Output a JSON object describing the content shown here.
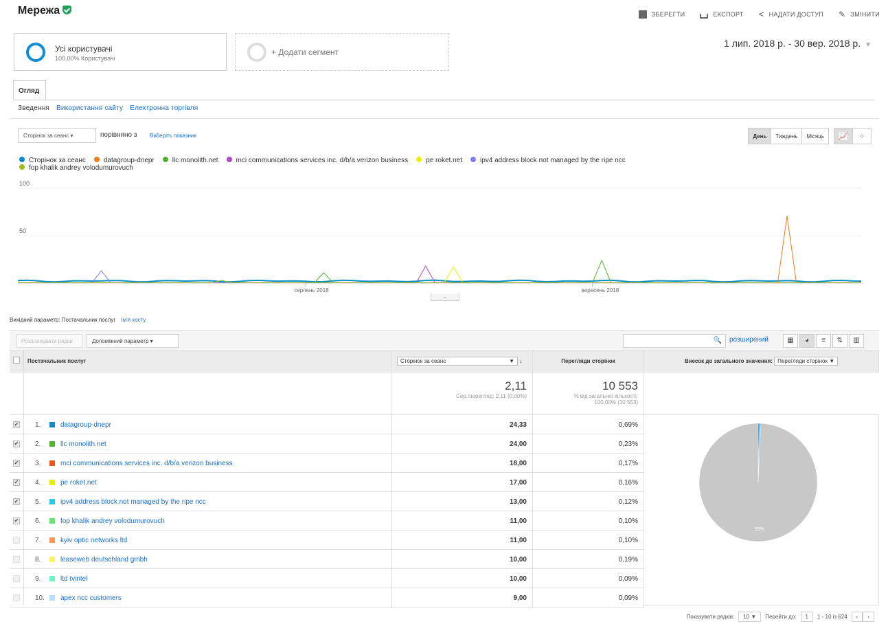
{
  "header": {
    "title": "Мережа",
    "save": "ЗБЕРЕГТИ",
    "export": "ЕКСПОРТ",
    "share": "НАДАТИ ДОСТУП",
    "edit": "ЗМІНИТИ"
  },
  "segments": {
    "all_users": "Усі користувачі",
    "all_users_sub": "100,00% Користувачі",
    "add": "+ Додати сегмент"
  },
  "date_range": "1 лип. 2018 р. - 30 вер. 2018 р.",
  "tab": "Огляд",
  "subnav": [
    "Зведення",
    "Використання сайту",
    "Електронна торгівля"
  ],
  "chart_controls": {
    "metric": "Сторінок за сеанс",
    "compare": "порівняно з",
    "choose_metric": "Виберіть показник",
    "day": "День",
    "week": "Тиждень",
    "month": "Місяць"
  },
  "chart_data": {
    "type": "line",
    "y_ticks": [
      "100",
      "50"
    ],
    "ylim": [
      0,
      100
    ],
    "x_ticks": [
      "серпень 2018",
      "вересень 2018"
    ],
    "series": [
      {
        "name": "Сторінок за сеанс",
        "color": "#058dc7",
        "peaks": []
      },
      {
        "name": "datagroup-dnepr",
        "color": "#ed7e17",
        "peaks": [
          {
            "day": 83,
            "value": 71
          }
        ]
      },
      {
        "name": "llc monolith.net",
        "color": "#50b432",
        "peaks": [
          {
            "day": 63,
            "value": 24
          },
          {
            "day": 33,
            "value": 11
          }
        ]
      },
      {
        "name": "mci communications services inc. d/b/a verizon business",
        "color": "#af49c5",
        "peaks": [
          {
            "day": 44,
            "value": 18
          }
        ]
      },
      {
        "name": "pe roket.net",
        "color": "#edef00",
        "peaks": [
          {
            "day": 47,
            "value": 17
          }
        ]
      },
      {
        "name": "ipv4 address block not managed by the ripe ncc",
        "color": "#8080ff",
        "peaks": [
          {
            "day": 9,
            "value": 13
          }
        ]
      },
      {
        "name": "fop khalik andrey volodumurovuch",
        "color": "#a0bd13",
        "peaks": [
          {
            "day": 22,
            "value": 3
          }
        ]
      }
    ]
  },
  "table": {
    "primary_label": "Вихідний параметр:",
    "primary_value": "Постачальник послуг",
    "primary_alt": "Ім'я хосту",
    "plot_rows": "Розпланувати рядки",
    "secondary": "Допоміжний параметр",
    "advanced": "розширений",
    "col_dim": "Постачальник послуг",
    "col_metric_sel": "Сторінок за сеанс",
    "col_pageviews": "Перегляди сторінок",
    "col_contrib": "Внесок до загального значення:",
    "col_contrib_sel": "Перегляди сторінок",
    "total_metric": "2,11",
    "total_metric_sub": "Сер./перегляд: 2,11 (0,00%)",
    "total_pv": "10 553",
    "total_pv_sub1": "% від загальної кількості:",
    "total_pv_sub2": "100,00% (10 553)",
    "rows": [
      {
        "num": "1.",
        "name": "datagroup-dnepr",
        "color": "#058dc7",
        "v": "24,33",
        "pct": "0,69%",
        "checked": true
      },
      {
        "num": "2.",
        "name": "llc monolith.net",
        "color": "#50b432",
        "v": "24,00",
        "pct": "0,23%",
        "checked": true
      },
      {
        "num": "3.",
        "name": "mci communications services inc. d/b/a verizon business",
        "color": "#ed561b",
        "v": "18,00",
        "pct": "0,17%",
        "checked": true
      },
      {
        "num": "4.",
        "name": "pe roket.net",
        "color": "#edef00",
        "v": "17,00",
        "pct": "0,16%",
        "checked": true
      },
      {
        "num": "5.",
        "name": "ipv4 address block not managed by the ripe ncc",
        "color": "#24cbe5",
        "v": "13,00",
        "pct": "0,12%",
        "checked": true
      },
      {
        "num": "6.",
        "name": "fop khalik andrey volodumurovuch",
        "color": "#64e572",
        "v": "11,00",
        "pct": "0,10%",
        "checked": true
      },
      {
        "num": "7.",
        "name": "kyiv optic networks ltd",
        "color": "#ff9655",
        "v": "11,00",
        "pct": "0,10%",
        "checked": false
      },
      {
        "num": "8.",
        "name": "leaseweb deutschland gmbh",
        "color": "#fff263",
        "v": "10,00",
        "pct": "0,19%",
        "checked": false
      },
      {
        "num": "9.",
        "name": "ltd tvintel",
        "color": "#6af9c4",
        "v": "10,00",
        "pct": "0,09%",
        "checked": false
      },
      {
        "num": "10.",
        "name": "apex ncc customers",
        "color": "#b2deff",
        "v": "9,00",
        "pct": "0,09%",
        "checked": false
      }
    ],
    "pie_label": "99%",
    "pie_share": 0.9931,
    "pager_rows_label": "Показувати рядків:",
    "pager_rows": "10",
    "pager_goto_label": "Перейти до:",
    "pager_goto": "1",
    "pager_range": "1 - 10 із 624"
  }
}
